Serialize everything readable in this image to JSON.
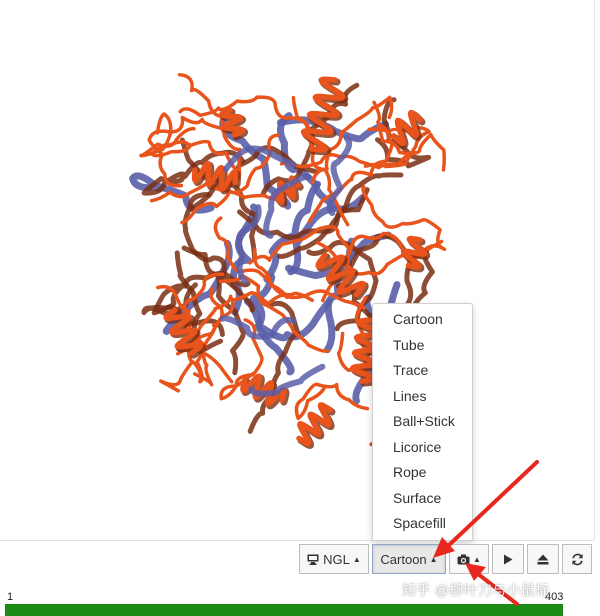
{
  "viewer": {
    "structure_style": "cartoon",
    "colors": {
      "helix": "#e8541c",
      "sheet": "#5a5fa8",
      "shadow": "#7a2e12"
    }
  },
  "representation_menu": {
    "items": [
      "Cartoon",
      "Tube",
      "Trace",
      "Lines",
      "Ball+Stick",
      "Licorice",
      "Rope",
      "Surface",
      "Spacefill"
    ]
  },
  "toolbar": {
    "ngl_label": "NGL",
    "representation_label": "Cartoon",
    "icons": {
      "ngl": "monitor-icon",
      "screenshot": "camera-icon",
      "play": "play-icon",
      "eject": "eject-icon",
      "refresh": "refresh-icon"
    }
  },
  "sequence": {
    "start": "1",
    "end": "403",
    "bar_color": "#1a8c16"
  },
  "annotation": {
    "arrow_color": "#e8281e"
  },
  "watermark": {
    "text": "知乎 @柳叶刀与小鼠标"
  }
}
